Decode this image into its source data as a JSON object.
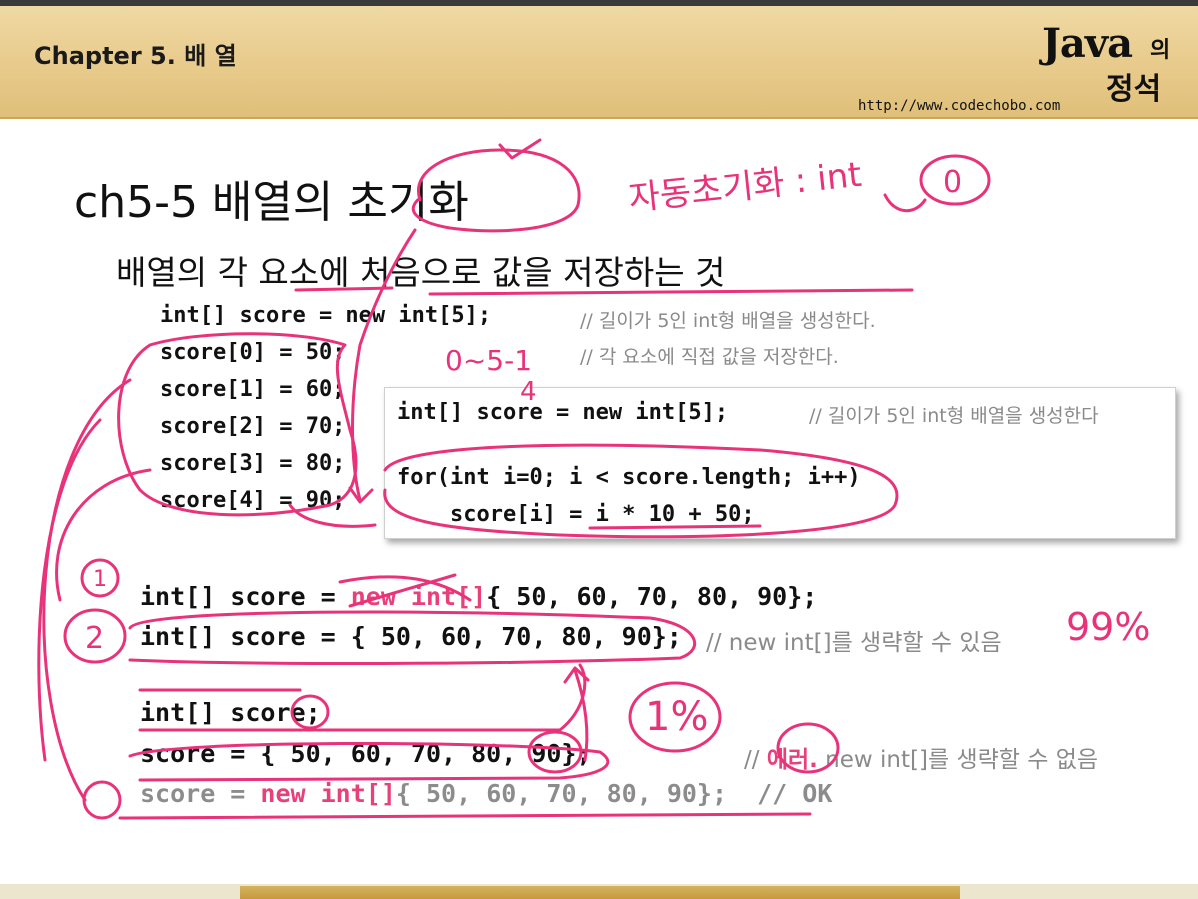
{
  "header": {
    "chapter": "Chapter 5. 배 열",
    "logo_java": "Java",
    "logo_ui": "의",
    "logo_jeongseok": "정석",
    "url": "http://www.codechobo.com"
  },
  "slide": {
    "title": "ch5-5 배열의 초기화",
    "subtitle": "배열의 각 요소에 처음으로 값을 저장하는 것"
  },
  "code_block1": {
    "lines": [
      "int[] score = new int[5];",
      "score[0] = 50;",
      "score[1] = 60;",
      "score[2] = 70;",
      "score[3] = 80;",
      "score[4] = 90;"
    ],
    "comment1": "// 길이가 5인 int형 배열을 생성한다.",
    "comment2": "// 각 요소에 직접 값을 저장한다."
  },
  "code_box": {
    "line1": "int[] score = new int[5];",
    "comment1": "// 길이가 5인 int형 배열을 생성한다",
    "line2": "for(int i=0; i < score.length; i++)",
    "line3": "    score[i] = i * 10 + 50;"
  },
  "code_block2": {
    "line1_prefix": "int[] score = ",
    "line1_new": "new int[]",
    "line1_suffix": "{ 50, 60, 70, 80, 90};",
    "line2": "int[] score = { 50, 60, 70, 80, 90};",
    "line2_comment": "// new int[]를 생략할 수 있음",
    "line3": "int[] score;",
    "line4": "score = { 50, 60, 70, 80, 90};",
    "line4_comment_prefix": "// ",
    "line4_comment_error": "에러.",
    "line4_comment_suffix": " new int[]를 생략할 수 없음",
    "line5_prefix": "score = ",
    "line5_new": "new int[]",
    "line5_suffix": "{ 50, 60, 70, 80, 90};  // OK"
  },
  "annotations": {
    "auto_init": "자동초기화 : int",
    "zero": "0",
    "range": "0~5-1",
    "four": "4",
    "circled_1": "1",
    "circled_2": "2",
    "pct_99": "99%",
    "pct_1": "1%"
  },
  "colors": {
    "header_bg": "#e7c989",
    "ink": "#e8337a",
    "keyword": "#e8407a",
    "comment": "#8a8a8a"
  }
}
